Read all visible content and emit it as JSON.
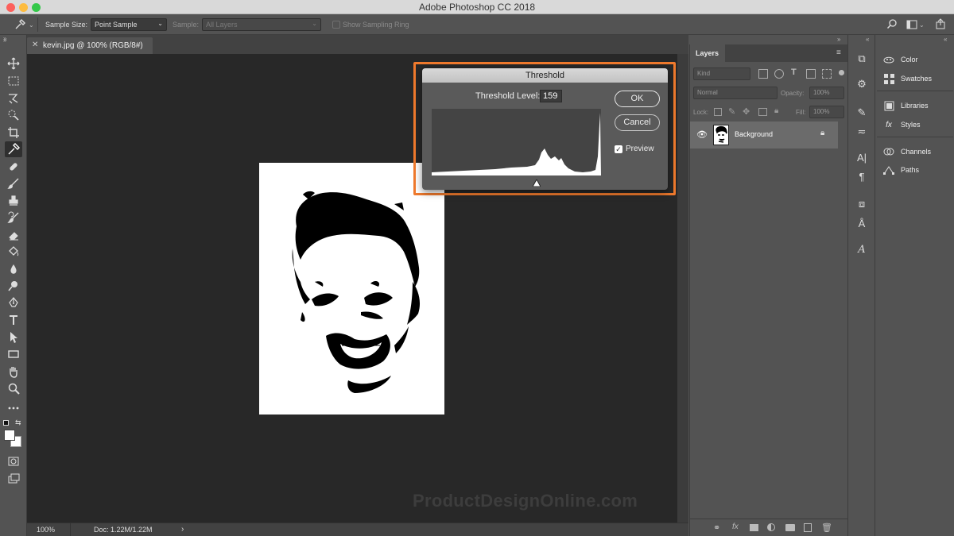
{
  "app": {
    "title": "Adobe Photoshop CC 2018"
  },
  "window_controls": {
    "close_color": "#fc605c",
    "minimize_color": "#fdbc40",
    "zoom_color": "#34c84a"
  },
  "options_bar": {
    "sample_size_label": "Sample Size:",
    "sample_size_value": "Point Sample",
    "sample_label": "Sample:",
    "sample_value": "All Layers",
    "sampling_ring_label": "Show Sampling Ring"
  },
  "document": {
    "tab_label": "kevin.jpg @ 100% (RGB/8#)",
    "zoom": "100%",
    "doc_size": "Doc: 1.22M/1.22M"
  },
  "threshold_dialog": {
    "title": "Threshold",
    "level_label": "Threshold Level:",
    "level_value": "159",
    "ok_label": "OK",
    "cancel_label": "Cancel",
    "preview_label": "Preview",
    "preview_checked": true,
    "highlight_color": "#f07a2d"
  },
  "layers_panel": {
    "tab_label": "Layers",
    "filter_placeholder": "Kind",
    "blend_mode": "Normal",
    "opacity_label": "Opacity:",
    "opacity_value": "100%",
    "lock_label": "Lock:",
    "fill_label": "Fill:",
    "fill_value": "100%",
    "layers": [
      {
        "name": "Background",
        "visible": true,
        "locked": true
      }
    ]
  },
  "right_panels": {
    "items": [
      "Color",
      "Swatches",
      "Libraries",
      "Styles",
      "Channels",
      "Paths"
    ]
  },
  "watermark": "ProductDesignOnline.com"
}
